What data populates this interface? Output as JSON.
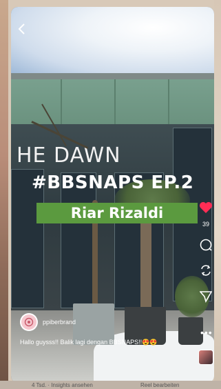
{
  "reel": {
    "sign_text": "HE DAWN",
    "title": "#BBSNAPS EP.2",
    "name_banner": "Riar Rizaldi"
  },
  "actions": {
    "like_count": "39",
    "like_color": "#ff2d55",
    "icons": [
      "chevron-left-icon",
      "heart-icon",
      "comment-icon",
      "repost-icon",
      "send-icon",
      "more-icon"
    ]
  },
  "author": {
    "username": "ppiberbrand"
  },
  "caption": "Hallo guysss!! Balik lagi dengan BBSNAPS!!😍😍",
  "footer": {
    "views": "4 Tsd. · Insights ansehen",
    "edit": "Reel bearbeiten"
  },
  "colors": {
    "banner_green": "#5b9a3f"
  }
}
